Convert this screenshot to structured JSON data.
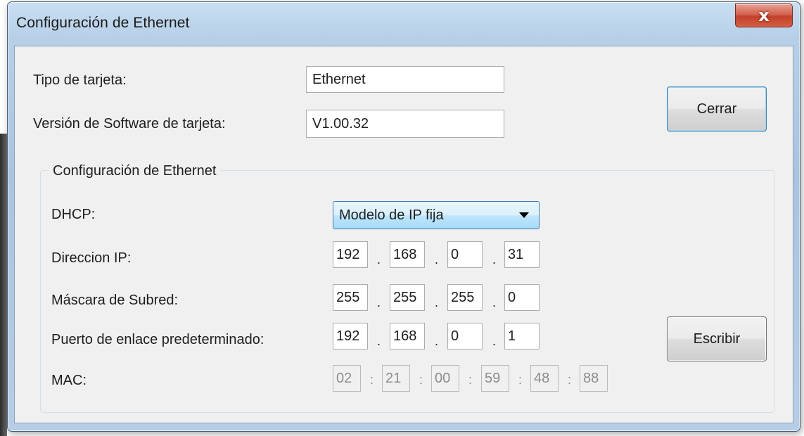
{
  "window": {
    "title": "Configuración de Ethernet",
    "close_glyph": "x"
  },
  "card": {
    "type_label": "Tipo de tarjeta:",
    "type_value": "Ethernet",
    "version_label": "Versión de Software de tarjeta:",
    "version_value": "V1.00.32"
  },
  "buttons": {
    "close": "Cerrar",
    "write": "Escribir"
  },
  "group": {
    "title": "Configuración de Ethernet",
    "dhcp_label": "DHCP:",
    "dhcp_value": "Modelo de IP fija",
    "ip_label": "Direccion IP:",
    "ip": [
      "192",
      "168",
      "0",
      "31"
    ],
    "mask_label": "Máscara de Subred:",
    "mask": [
      "255",
      "255",
      "255",
      "0"
    ],
    "gateway_label": "Puerto de enlace predeterminado:",
    "gateway": [
      "192",
      "168",
      "0",
      "1"
    ],
    "mac_label": "MAC:",
    "mac": [
      "02",
      "21",
      "00",
      "59",
      "48",
      "88"
    ],
    "dot": ".",
    "colon": ":"
  }
}
